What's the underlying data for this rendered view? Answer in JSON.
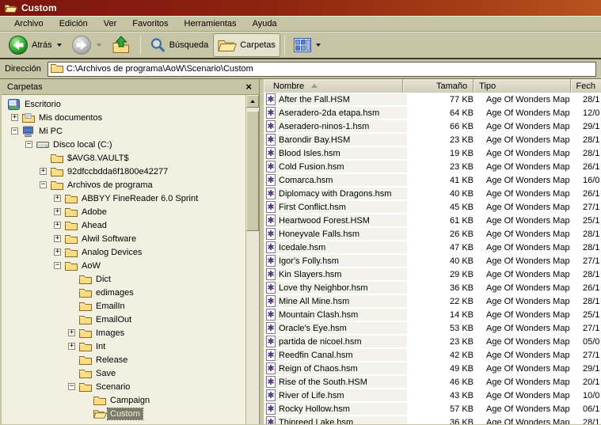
{
  "window": {
    "title": "Custom"
  },
  "menu": {
    "items": [
      "Archivo",
      "Edición",
      "Ver",
      "Favoritos",
      "Herramientas",
      "Ayuda"
    ]
  },
  "toolbar": {
    "back_label": "Atrás",
    "search_label": "Búsqueda",
    "folders_label": "Carpetas",
    "icons": [
      "back-icon",
      "forward-icon",
      "up-folder-icon",
      "search-icon",
      "folders-icon",
      "views-icon"
    ]
  },
  "address": {
    "label": "Dirección",
    "value": "C:\\Archivos de programa\\AoW\\Scenario\\Custom"
  },
  "folders_panel": {
    "title": "Carpetas",
    "close_glyph": "×",
    "tree": [
      {
        "label": "Escritorio",
        "level": 0,
        "toggle": null,
        "icon": "desktop"
      },
      {
        "label": "Mis documentos",
        "level": 1,
        "toggle": "plus",
        "icon": "mydocs"
      },
      {
        "label": "Mi PC",
        "level": 1,
        "toggle": "minus",
        "icon": "mypc"
      },
      {
        "label": "Disco local (C:)",
        "level": 2,
        "toggle": "minus",
        "icon": "drive"
      },
      {
        "label": "$AVG8.VAULT$",
        "level": 3,
        "toggle": null,
        "icon": "folder"
      },
      {
        "label": "92dfccbdda6f1800e42277",
        "level": 3,
        "toggle": "plus",
        "icon": "folder"
      },
      {
        "label": "Archivos de programa",
        "level": 3,
        "toggle": "minus",
        "icon": "folder"
      },
      {
        "label": "ABBYY FineReader 6.0 Sprint",
        "level": 4,
        "toggle": "plus",
        "icon": "folder"
      },
      {
        "label": "Adobe",
        "level": 4,
        "toggle": "plus",
        "icon": "folder"
      },
      {
        "label": "Ahead",
        "level": 4,
        "toggle": "plus",
        "icon": "folder"
      },
      {
        "label": "Alwil Software",
        "level": 4,
        "toggle": "plus",
        "icon": "folder"
      },
      {
        "label": "Analog Devices",
        "level": 4,
        "toggle": "plus",
        "icon": "folder"
      },
      {
        "label": "AoW",
        "level": 4,
        "toggle": "minus",
        "icon": "folder"
      },
      {
        "label": "Dict",
        "level": 5,
        "toggle": null,
        "icon": "folder"
      },
      {
        "label": "edimages",
        "level": 5,
        "toggle": null,
        "icon": "folder"
      },
      {
        "label": "EmailIn",
        "level": 5,
        "toggle": null,
        "icon": "folder"
      },
      {
        "label": "EmailOut",
        "level": 5,
        "toggle": null,
        "icon": "folder"
      },
      {
        "label": "Images",
        "level": 5,
        "toggle": "plus",
        "icon": "folder"
      },
      {
        "label": "Int",
        "level": 5,
        "toggle": "plus",
        "icon": "folder"
      },
      {
        "label": "Release",
        "level": 5,
        "toggle": null,
        "icon": "folder"
      },
      {
        "label": "Save",
        "level": 5,
        "toggle": null,
        "icon": "folder"
      },
      {
        "label": "Scenario",
        "level": 5,
        "toggle": "minus",
        "icon": "folder"
      },
      {
        "label": "Campaign",
        "level": 6,
        "toggle": null,
        "icon": "folder"
      },
      {
        "label": "Custom",
        "level": 6,
        "toggle": null,
        "icon": "folder-open",
        "selected": true
      }
    ]
  },
  "file_list": {
    "columns": [
      {
        "label": "Nombre",
        "sort": "asc"
      },
      {
        "label": "Tamaño",
        "sort": null
      },
      {
        "label": "Tipo",
        "sort": null
      },
      {
        "label": "Fech",
        "sort": null
      }
    ],
    "rows": [
      {
        "name": "After the Fall.HSM",
        "size": "77 KB",
        "type": "Age Of Wonders Map",
        "date": "28/1"
      },
      {
        "name": "Aseradero-2da etapa.hsm",
        "size": "64 KB",
        "type": "Age Of Wonders Map",
        "date": "12/0"
      },
      {
        "name": "Aseradero-ninos-1.hsm",
        "size": "66 KB",
        "type": "Age Of Wonders Map",
        "date": "29/1"
      },
      {
        "name": "Barondir Bay.HSM",
        "size": "23 KB",
        "type": "Age Of Wonders Map",
        "date": "28/1"
      },
      {
        "name": "Blood Isles.hsm",
        "size": "19 KB",
        "type": "Age Of Wonders Map",
        "date": "28/1"
      },
      {
        "name": "Cold Fusion.hsm",
        "size": "23 KB",
        "type": "Age Of Wonders Map",
        "date": "26/1"
      },
      {
        "name": "Comarca.hsm",
        "size": "41 KB",
        "type": "Age Of Wonders Map",
        "date": "16/0"
      },
      {
        "name": "Diplomacy with Dragons.hsm",
        "size": "40 KB",
        "type": "Age Of Wonders Map",
        "date": "26/1"
      },
      {
        "name": "First Conflict.hsm",
        "size": "45 KB",
        "type": "Age Of Wonders Map",
        "date": "27/1"
      },
      {
        "name": "Heartwood Forest.HSM",
        "size": "61 KB",
        "type": "Age Of Wonders Map",
        "date": "25/1"
      },
      {
        "name": "Honeyvale Falls.hsm",
        "size": "26 KB",
        "type": "Age Of Wonders Map",
        "date": "28/1"
      },
      {
        "name": "Icedale.hsm",
        "size": "47 KB",
        "type": "Age Of Wonders Map",
        "date": "28/1"
      },
      {
        "name": "Igor's Folly.hsm",
        "size": "40 KB",
        "type": "Age Of Wonders Map",
        "date": "27/1"
      },
      {
        "name": "Kin Slayers.hsm",
        "size": "29 KB",
        "type": "Age Of Wonders Map",
        "date": "28/1"
      },
      {
        "name": "Love thy Neighbor.hsm",
        "size": "36 KB",
        "type": "Age Of Wonders Map",
        "date": "26/1"
      },
      {
        "name": "Mine All Mine.hsm",
        "size": "22 KB",
        "type": "Age Of Wonders Map",
        "date": "28/1"
      },
      {
        "name": "Mountain Clash.hsm",
        "size": "14 KB",
        "type": "Age Of Wonders Map",
        "date": "25/1"
      },
      {
        "name": "Oracle's Eye.hsm",
        "size": "53 KB",
        "type": "Age Of Wonders Map",
        "date": "27/1"
      },
      {
        "name": "partida de nicoel.hsm",
        "size": "23 KB",
        "type": "Age Of Wonders Map",
        "date": "05/0"
      },
      {
        "name": "Reedfin Canal.hsm",
        "size": "42 KB",
        "type": "Age Of Wonders Map",
        "date": "27/1"
      },
      {
        "name": "Reign of Chaos.hsm",
        "size": "49 KB",
        "type": "Age Of Wonders Map",
        "date": "29/1"
      },
      {
        "name": "Rise of the South.HSM",
        "size": "46 KB",
        "type": "Age Of Wonders Map",
        "date": "20/1"
      },
      {
        "name": "River of Life.hsm",
        "size": "43 KB",
        "type": "Age Of Wonders Map",
        "date": "10/0"
      },
      {
        "name": "Rocky Hollow.hsm",
        "size": "57 KB",
        "type": "Age Of Wonders Map",
        "date": "06/1"
      },
      {
        "name": "Thinreed Lake.hsm",
        "size": "36 KB",
        "type": "Age Of Wonders Map",
        "date": "28/1"
      }
    ]
  },
  "colors": {
    "titlebar_gradient_left": "#7c150d",
    "titlebar_gradient_right": "#b85320",
    "chrome": "#c8c5a6",
    "tree_background": "#f2f0e1",
    "selected_item_background": "#7c7c68",
    "selected_item_text": "#f4f2dd",
    "sorted_column_tint": "#f3f3ec",
    "folder_yellow": "#f3cd69"
  }
}
